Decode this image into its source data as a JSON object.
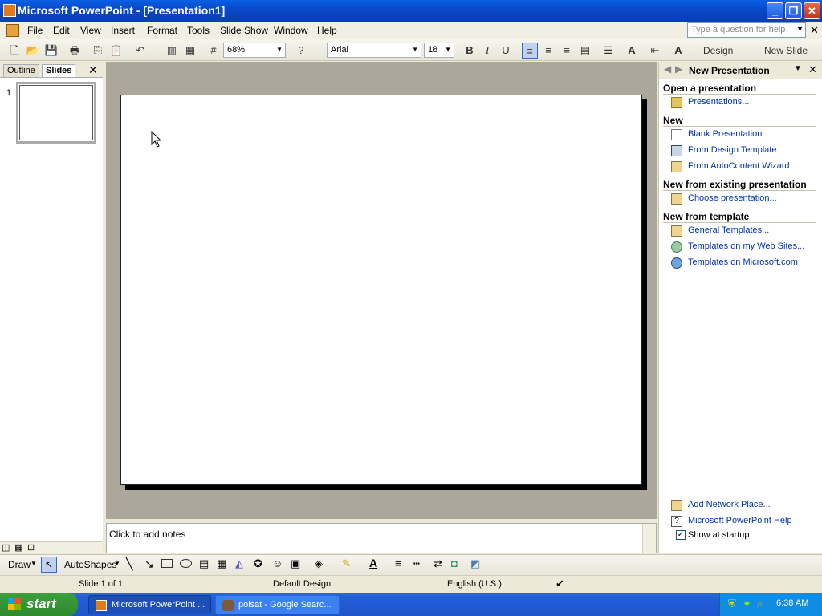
{
  "window": {
    "title": "Microsoft PowerPoint - [Presentation1]"
  },
  "menu": [
    "File",
    "Edit",
    "View",
    "Insert",
    "Format",
    "Tools",
    "Slide Show",
    "Window",
    "Help"
  ],
  "help_placeholder": "Type a question for help",
  "toolbar": {
    "zoom": "68%",
    "font": "Arial",
    "font_size": "18",
    "design": "Design",
    "new_slide": "New Slide",
    "bold": "B",
    "italic": "I",
    "underline": "U"
  },
  "leftpane": {
    "tabs": [
      "Outline",
      "Slides"
    ],
    "slide_number": "1"
  },
  "notes_placeholder": "Click to add notes",
  "taskpane": {
    "title": "New Presentation",
    "sections": {
      "open": {
        "title": "Open a presentation",
        "items": [
          "Presentations..."
        ]
      },
      "new": {
        "title": "New",
        "items": [
          "Blank Presentation",
          "From Design Template",
          "From AutoContent Wizard"
        ]
      },
      "existing": {
        "title": "New from existing presentation",
        "items": [
          "Choose presentation..."
        ]
      },
      "template": {
        "title": "New from template",
        "items": [
          "General Templates...",
          "Templates on my Web Sites...",
          "Templates on Microsoft.com"
        ]
      }
    },
    "footer": [
      "Add Network Place...",
      "Microsoft PowerPoint Help"
    ],
    "show_at_startup": "Show at startup"
  },
  "drawbar": {
    "draw": "Draw",
    "autoshapes": "AutoShapes"
  },
  "status": {
    "slide": "Slide 1 of 1",
    "design": "Default Design",
    "language": "English (U.S.)"
  },
  "taskbar": {
    "start": "start",
    "buttons": [
      "Microsoft PowerPoint ...",
      "polsat - Google Searc..."
    ],
    "time": "6:38 AM"
  }
}
